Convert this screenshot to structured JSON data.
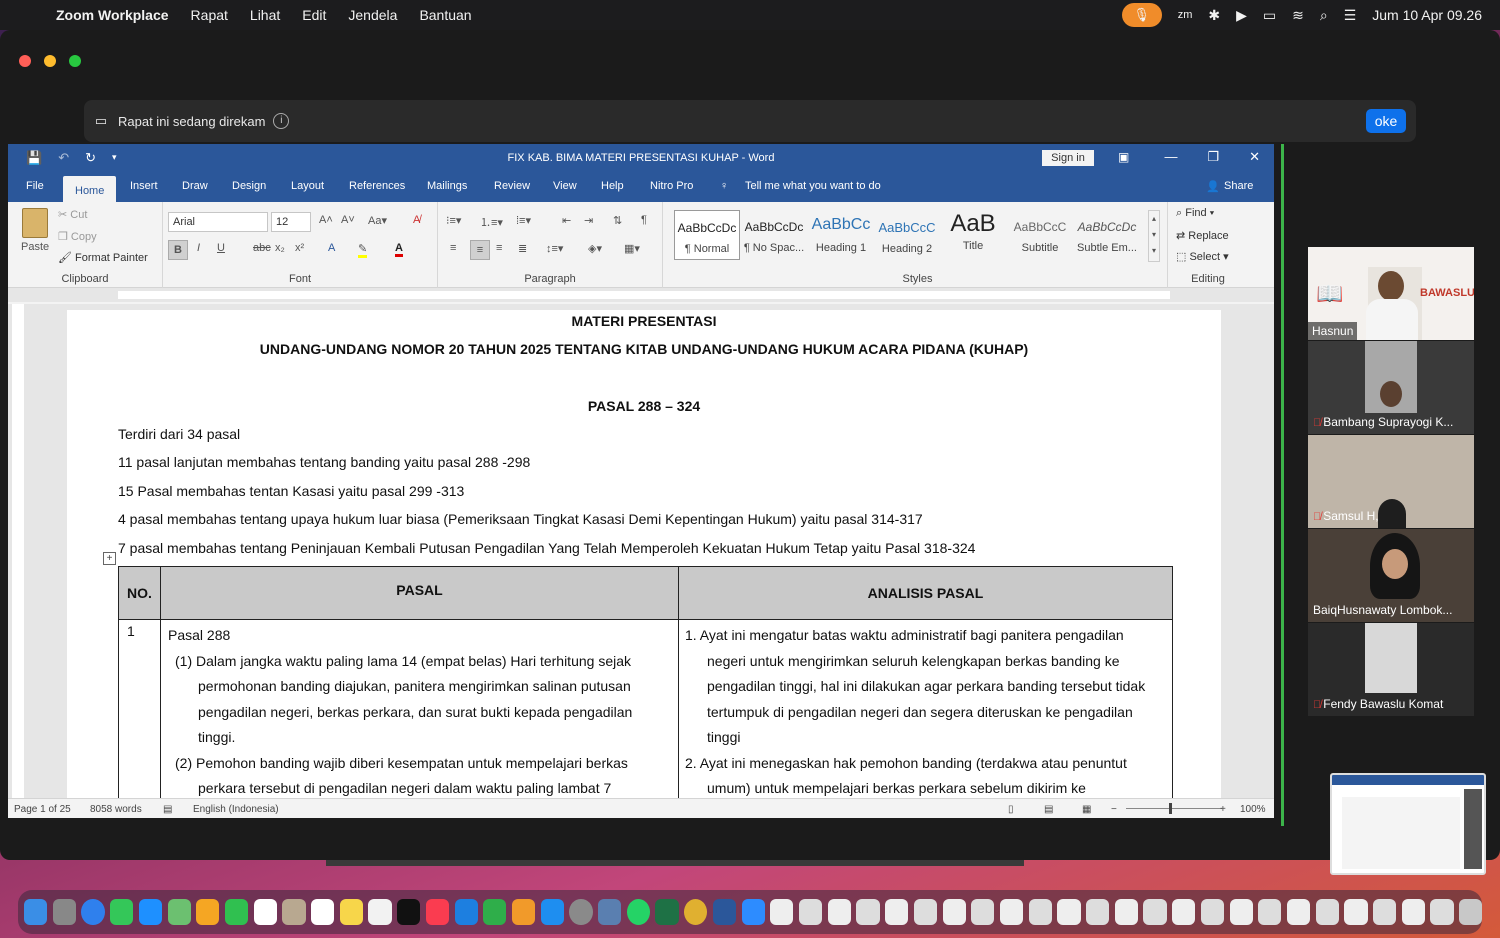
{
  "menubar": {
    "app_name": "Zoom Workplace",
    "menus": [
      "Rapat",
      "Lihat",
      "Edit",
      "Jendela",
      "Bantuan"
    ],
    "datetime": "Jum 10 Apr  09.26"
  },
  "zoom": {
    "recording_notice": "Rapat ini sedang direkam",
    "ok_label": "oke",
    "participants": [
      {
        "name": "Hasnun",
        "muted": false
      },
      {
        "name": "Bambang Suprayogi K...",
        "muted": true
      },
      {
        "name": "Samsul H,",
        "muted": true
      },
      {
        "name": "BaiqHusnawaty Lombok...",
        "muted": false
      },
      {
        "name": "Fendy Bawaslu Komat",
        "muted": true
      }
    ],
    "bawaslu_label": "BAWASLU"
  },
  "word": {
    "title": "FIX KAB. BIMA MATERI PRESENTASI KUHAP  -  Word",
    "sign_in": "Sign in",
    "tabs": [
      "File",
      "Home",
      "Insert",
      "Draw",
      "Design",
      "Layout",
      "References",
      "Mailings",
      "Review",
      "View",
      "Help",
      "Nitro Pro"
    ],
    "tell_me": "Tell me what you want to do",
    "share": "Share",
    "ribbon": {
      "clipboard": {
        "paste": "Paste",
        "cut": "Cut",
        "copy": "Copy",
        "format_painter": "Format Painter",
        "label": "Clipboard"
      },
      "font": {
        "name": "Arial",
        "size": "12",
        "label": "Font"
      },
      "paragraph": {
        "label": "Paragraph"
      },
      "styles": {
        "label": "Styles",
        "items": [
          {
            "preview": "AaBbCcDc",
            "name": "¶ Normal"
          },
          {
            "preview": "AaBbCcDc",
            "name": "¶ No Spac..."
          },
          {
            "preview": "AaBbCc",
            "name": "Heading 1"
          },
          {
            "preview": "AaBbCcC",
            "name": "Heading 2"
          },
          {
            "preview": "AaB",
            "name": "Title"
          },
          {
            "preview": "AaBbCcC",
            "name": "Subtitle"
          },
          {
            "preview": "AaBbCcDc",
            "name": "Subtle Em..."
          }
        ]
      },
      "editing": {
        "find": "Find",
        "replace": "Replace",
        "select": "Select",
        "label": "Editing"
      }
    },
    "document": {
      "heading1": "MATERI PRESENTASI",
      "heading2": "UNDANG-UNDANG NOMOR 20 TAHUN 2025 TENTANG KITAB UNDANG-UNDANG HUKUM ACARA PIDANA (KUHAP)",
      "heading3": "PASAL 288 – 324",
      "lines": [
        "Terdiri dari 34 pasal",
        "11 pasal lanjutan membahas tentang banding yaitu pasal 288 -298",
        "15 Pasal membahas tentan Kasasi yaitu pasal 299 -313",
        "4 pasal membahas tentang upaya hukum luar biasa (Pemeriksaan Tingkat Kasasi Demi Kepentingan Hukum)  yaitu pasal 314-317",
        "7 pasal membahas tentang Peninjauan Kembali Putusan Pengadilan Yang Telah Memperoleh Kekuatan Hukum Tetap yaitu Pasal 318-324"
      ],
      "table": {
        "headers": [
          "NO.",
          "PASAL",
          "ANALISIS PASAL"
        ],
        "row_no": "1",
        "pasal_title": "Pasal 288",
        "pasal_items": [
          "(1) Dalam jangka waktu paling lama 14 (empat belas) Hari terhitung sejak permohonan banding diajukan, panitera mengirimkan salinan putusan pengadilan negeri, berkas perkara, dan surat bukti kepada pengadilan tinggi.",
          "(2) Pemohon banding wajib diberi kesempatan untuk mempelajari berkas perkara tersebut di pengadilan negeri dalam waktu paling lambat 7"
        ],
        "analisis_items": [
          "1.   Ayat ini mengatur batas waktu administratif bagi panitera pengadilan negeri untuk mengirimkan seluruh kelengkapan berkas banding ke pengadilan tinggi, hal ini dilakukan agar perkara banding tersebut tidak tertumpuk di pengadilan negeri dan segera diteruskan ke pengadilan tinggi",
          "2.   Ayat ini menegaskan hak pemohon banding (terdakwa atau penuntut umum) untuk mempelajari berkas perkara sebelum dikirim ke"
        ]
      }
    },
    "status": {
      "page": "Page 1 of 25",
      "words": "8058 words",
      "language": "English (Indonesia)",
      "zoom": "100%"
    }
  }
}
